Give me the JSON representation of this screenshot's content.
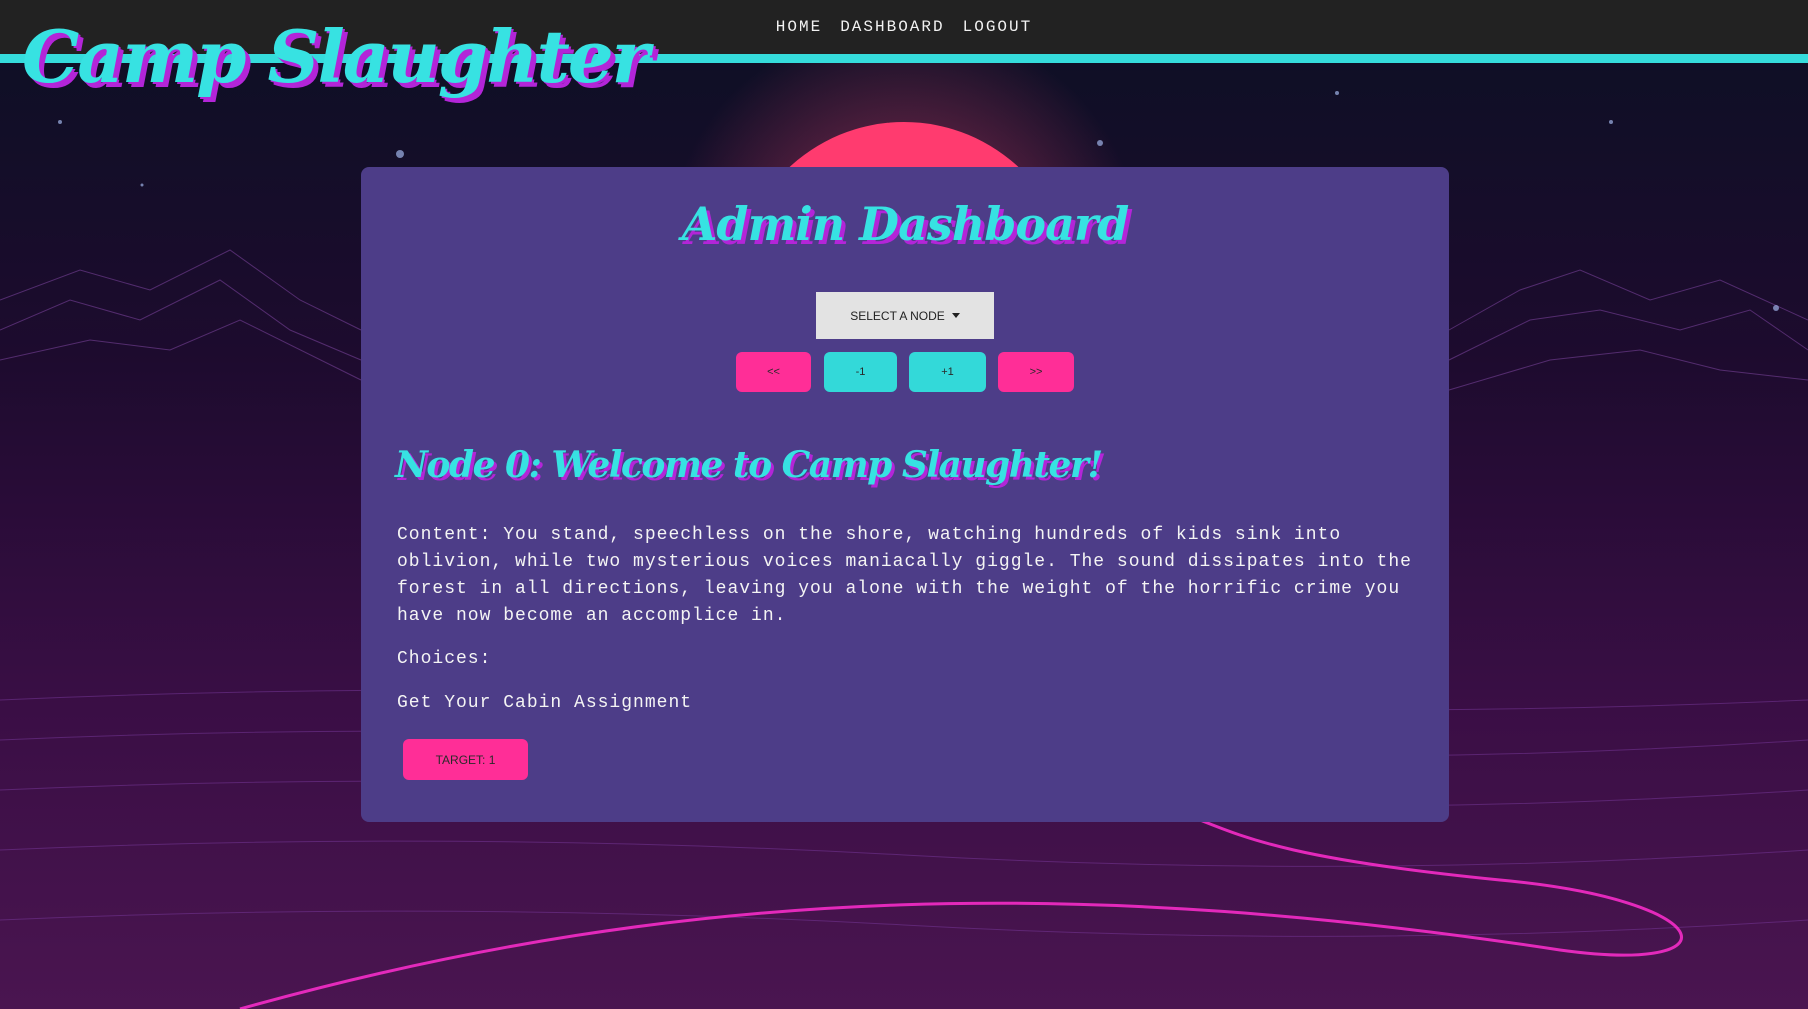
{
  "site": {
    "logo": "Camp Slaughter"
  },
  "nav": {
    "items": [
      {
        "label": "HOME"
      },
      {
        "label": "DASHBOARD"
      },
      {
        "label": "LOGOUT"
      }
    ]
  },
  "dashboard": {
    "title": "Admin Dashboard",
    "select_label": "SELECT A NODE",
    "controls": {
      "first": "<<",
      "prev": "-1",
      "next": "+1",
      "last": ">>"
    }
  },
  "node": {
    "title": "Node 0: Welcome to Camp Slaughter!",
    "content": "Content: You stand, speechless on the shore, watching hundreds of kids sink into oblivion, while two mysterious voices maniacally giggle. The sound dissipates into the forest in all directions, leaving you alone with the weight of the horrific crime you have now become an accomplice in.",
    "choices_label": "Choices:",
    "choices": [
      {
        "text": "Get Your Cabin Assignment",
        "target_label": "TARGET: 1"
      }
    ]
  },
  "colors": {
    "accent_cyan": "#35dcdc",
    "accent_pink": "#ff2e97",
    "panel": "#4d3d88",
    "navbar": "#222222"
  }
}
